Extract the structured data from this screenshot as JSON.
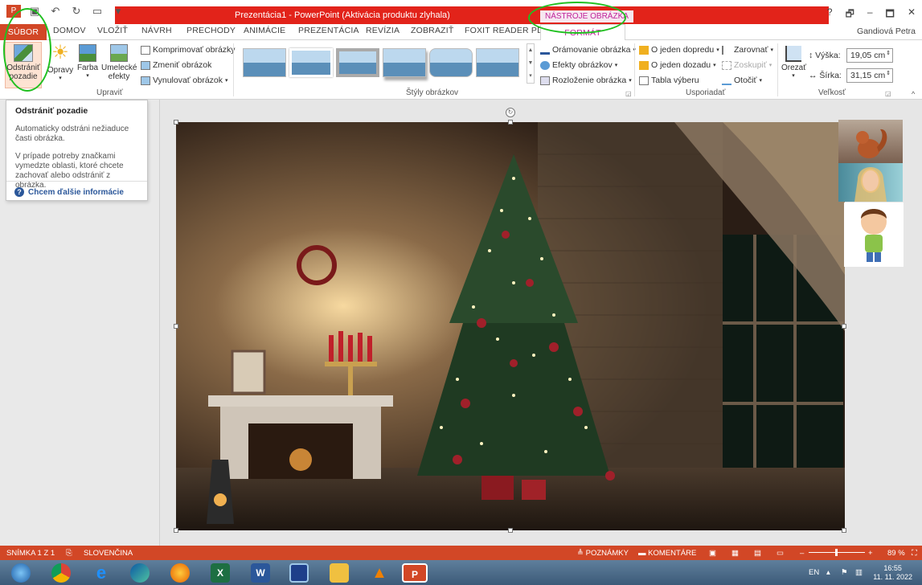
{
  "titlebar": {
    "app_title": "Prezentácia1 - PowerPoint (Aktivácia produktu zlyhala)",
    "contextual_label": "NÁSTROJE OBRÁZKA",
    "help": "?",
    "restore": "🗗",
    "minimize": "–",
    "maximize": "🗖",
    "close": "✕"
  },
  "tabs": {
    "file": "SÚBOR",
    "home": "DOMOV",
    "insert": "VLOŽIŤ",
    "design": "NÁVRH",
    "transitions": "PRECHODY",
    "animations": "ANIMÁCIE",
    "presentation": "PREZENTÁCIA",
    "review": "REVÍZIA",
    "view": "ZOBRAZIŤ",
    "foxit": "FOXIT READER PDF",
    "format": "FORMÁT",
    "user": "Gandiová Petra"
  },
  "ribbon": {
    "adjust": {
      "remove_bg_line1": "Odstrániť",
      "remove_bg_line2": "pozadie",
      "corrections": "Opravy",
      "color": "Farba",
      "artistic_line1": "Umelecké",
      "artistic_line2": "efekty",
      "compress": "Komprimovať obrázky",
      "change": "Zmeniť obrázok",
      "reset": "Vynulovať obrázok",
      "group_label": "Upraviť"
    },
    "styles": {
      "border": "Orámovanie obrázka",
      "effects": "Efekty obrázkov",
      "layout": "Rozloženie obrázka",
      "group_label": "Štýly obrázkov"
    },
    "arrange": {
      "forward": "O jeden dopredu",
      "backward": "O jeden dozadu",
      "selection": "Tabla výberu",
      "align": "Zarovnať",
      "group": "Zoskupiť",
      "rotate": "Otočiť",
      "group_label": "Usporiadať"
    },
    "size": {
      "crop": "Orezať",
      "height_label": "Výška:",
      "height_value": "19,05 cm",
      "width_label": "Šírka:",
      "width_value": "31,15 cm",
      "group_label": "Veľkosť"
    }
  },
  "tooltip": {
    "title": "Odstrániť pozadie",
    "body1": "Automaticky odstráni nežiaduce časti obrázka.",
    "body2": "V prípade potreby značkami vymedzte oblasti, ktoré chcete zachovať alebo odstrániť z obrázka.",
    "link": "Chcem ďalšie informácie"
  },
  "statusbar": {
    "slide": "SNÍMKA 1 Z 1",
    "language": "SLOVENČINA",
    "notes": "POZNÁMKY",
    "comments": "KOMENTÁRE",
    "zoom": "89 %"
  },
  "taskbar": {
    "lang": "EN",
    "time": "16:55",
    "date": "11. 11. 2022"
  },
  "colors": {
    "accent": "#d24726",
    "titlebar_red": "#e2231a",
    "format_tab": "#c0239a",
    "highlight": "#20c020"
  }
}
